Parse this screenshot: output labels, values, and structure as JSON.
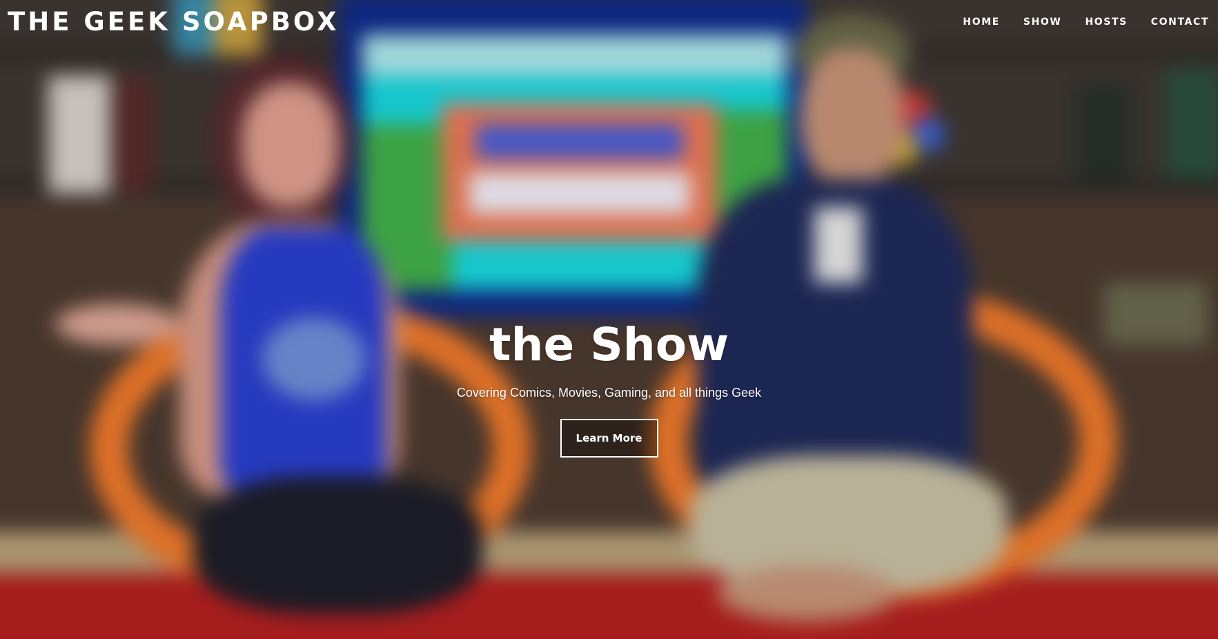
{
  "header": {
    "site_title": "THE GEEK SOAPBOX",
    "nav": [
      {
        "label": "HOME"
      },
      {
        "label": "SHOW"
      },
      {
        "label": "HOSTS"
      },
      {
        "label": "CONTACT"
      }
    ]
  },
  "hero": {
    "headline": "the Show",
    "subtitle": "Covering Comics, Movies, Gaming, and all things Geek",
    "cta_label": "Learn More",
    "background_image": "blurred-studio-photo-of-two-hosts"
  },
  "colors": {
    "text": "#ffffff",
    "screen_cyan": "#18d8de",
    "sign_orange": "#ee7a57",
    "chair_orange": "#f07a2c",
    "shirt_blue": "#2a3fd0",
    "floor_red": "#b42020"
  }
}
